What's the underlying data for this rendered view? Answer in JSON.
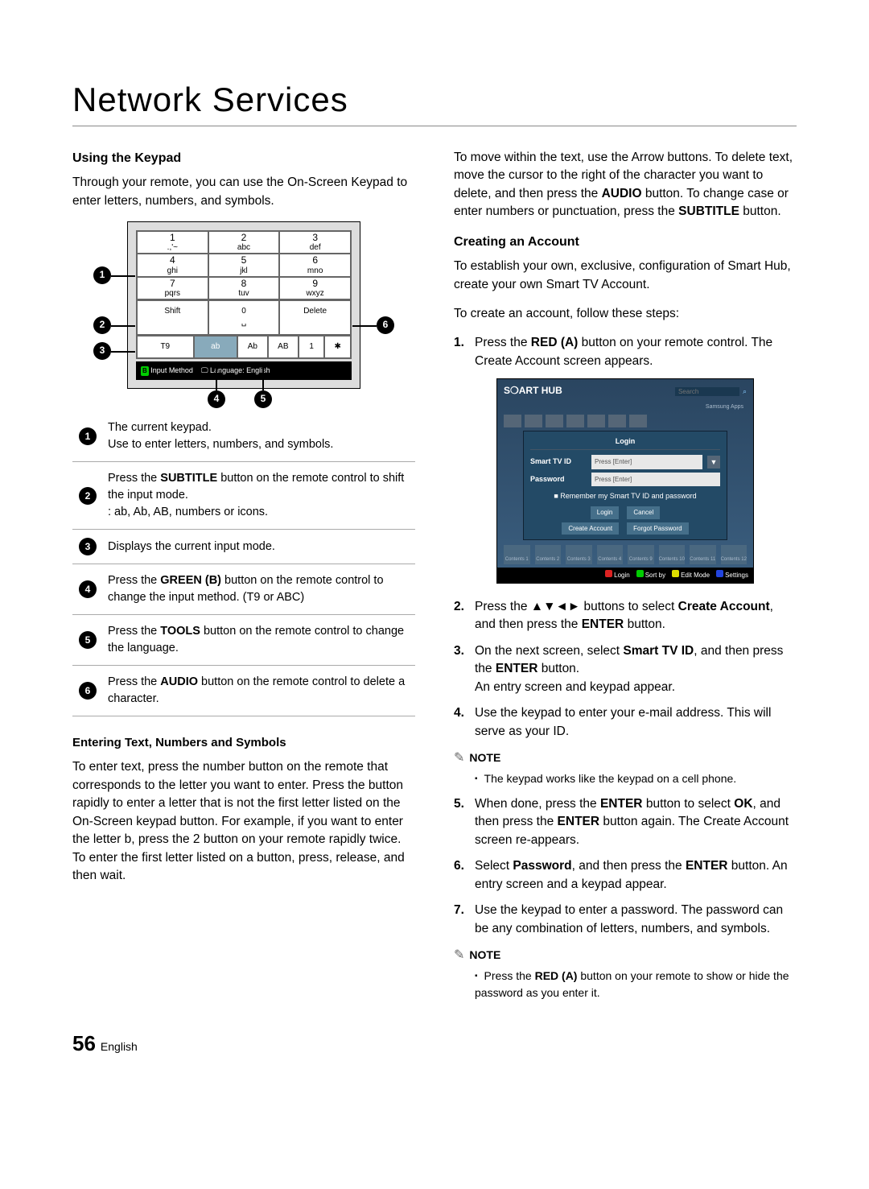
{
  "page": {
    "title": "Network Services",
    "number": "56",
    "language": "English"
  },
  "left": {
    "h1": "Using the Keypad",
    "p1": "Through your remote, you can use the On-Screen Keypad to enter letters, numbers, and symbols.",
    "keypad": {
      "cells": [
        {
          "n": "1",
          "t": ".,'~"
        },
        {
          "n": "2",
          "t": "abc"
        },
        {
          "n": "3",
          "t": "def"
        },
        {
          "n": "4",
          "t": "ghi"
        },
        {
          "n": "5",
          "t": "jkl"
        },
        {
          "n": "6",
          "t": "mno"
        },
        {
          "n": "7",
          "t": "pqrs"
        },
        {
          "n": "8",
          "t": "tuv"
        },
        {
          "n": "9",
          "t": "wxyz"
        }
      ],
      "shift": "Shift",
      "zero": "0",
      "zeroSub": "␣",
      "delete": "Delete",
      "modes": [
        "T9",
        "ab",
        "Ab",
        "AB",
        "1",
        "✱"
      ],
      "bar1": "Input Method",
      "bar2": "Language: English",
      "barChip": "B",
      "barIcon": "🖵"
    },
    "legend": [
      {
        "n": "1",
        "t1": "The current keypad.",
        "t2": "Use to enter letters, numbers, and symbols."
      },
      {
        "n": "2",
        "pre": "Press the ",
        "b": "SUBTITLE",
        "post": " button on the remote control to shift the input mode.",
        "t2": ": ab, Ab, AB, numbers or icons."
      },
      {
        "n": "3",
        "t": "Displays the current input mode."
      },
      {
        "n": "4",
        "pre": "Press the ",
        "b": "GREEN (B)",
        "post": " button on the remote control to change the input method. (T9 or ABC)"
      },
      {
        "n": "5",
        "pre": "Press the ",
        "b": "TOOLS",
        "post": " button on the remote control to change the language."
      },
      {
        "n": "6",
        "pre": "Press the ",
        "b": "AUDIO",
        "post": " button on the remote control to delete a character."
      }
    ],
    "h2": "Entering Text, Numbers and Symbols",
    "p2": "To enter text, press the number button on the remote that corresponds to the letter you want to enter. Press the button rapidly to enter a letter that is not the first letter listed on the On-Screen keypad button. For example, if you want to enter the letter b, press the 2 button on your remote rapidly twice. To enter the first letter listed on a button, press, release, and then wait."
  },
  "right": {
    "p1a": "To move within the text, use the Arrow buttons. To delete text, move the cursor to the right of the character you want to delete, and then press the ",
    "p1b": " button. To change case or enter numbers or punctuation, press the ",
    "p1c": " button.",
    "audio": "AUDIO",
    "subtitle": "SUBTITLE",
    "h1": "Creating an Account",
    "p2": "To establish your own, exclusive, configuration of Smart Hub, create your own Smart TV Account.",
    "p3": "To create an account, follow these steps:",
    "step1a": "Press the ",
    "step1b": "RED (A)",
    "step1c": " button on your remote control. The Create Account screen appears.",
    "hub": {
      "logo": "S❍ART HUB",
      "search": "Search",
      "samsApps": "Samsung Apps",
      "loginTitle": "Login",
      "idLabel": "Smart TV ID",
      "pwLabel": "Password",
      "pressEnter": "Press [Enter]",
      "remember": "Remember my Smart TV ID and password",
      "btnLogin": "Login",
      "btnCancel": "Cancel",
      "btnCreate": "Create Account",
      "btnForgot": "Forgot Password",
      "tileLabels": [
        "Contents 1",
        "Contents 2",
        "Contents 3",
        "Contents 4",
        "Contents 9",
        "Contents 10",
        "Contents 11",
        "Contents 12"
      ],
      "foot": [
        {
          "c": "#d22",
          "t": "Login"
        },
        {
          "c": "#0c0",
          "t": "Sort by"
        },
        {
          "c": "#dd0",
          "t": "Edit Mode"
        },
        {
          "c": "#24d",
          "t": "Settings"
        }
      ]
    },
    "step2a": "Press the ",
    "step2arrows": "▲▼◄►",
    "step2b": " buttons to select ",
    "step2c": "Create Account",
    "step2d": ", and then press the ",
    "step2e": "ENTER",
    "step2f": " button.",
    "step3a": "On the next screen, select ",
    "step3b": "Smart TV ID",
    "step3c": ", and then press the ",
    "step3d": "ENTER",
    "step3e": " button.",
    "step3f": "An entry screen and keypad appear.",
    "step4": "Use the keypad to enter your e-mail address. This will serve as your ID.",
    "note1": "NOTE",
    "note1item": "The keypad works like the keypad on a cell phone.",
    "step5a": "When done, press the ",
    "step5b": "ENTER",
    "step5c": " button to select ",
    "step5d": "OK",
    "step5e": ", and then press the ",
    "step5f": "ENTER",
    "step5g": " button again. The Create Account screen re-appears.",
    "step6a": "Select ",
    "step6b": "Password",
    "step6c": ", and then press the ",
    "step6d": "ENTER",
    "step6e": " button. An entry screen and a keypad appear.",
    "step7": "Use the keypad to enter a password. The password can be any combination of letters, numbers, and symbols.",
    "note2": "NOTE",
    "note2a": "Press the ",
    "note2b": "RED (A)",
    "note2c": " button on your remote to show or hide the password as you enter it."
  }
}
